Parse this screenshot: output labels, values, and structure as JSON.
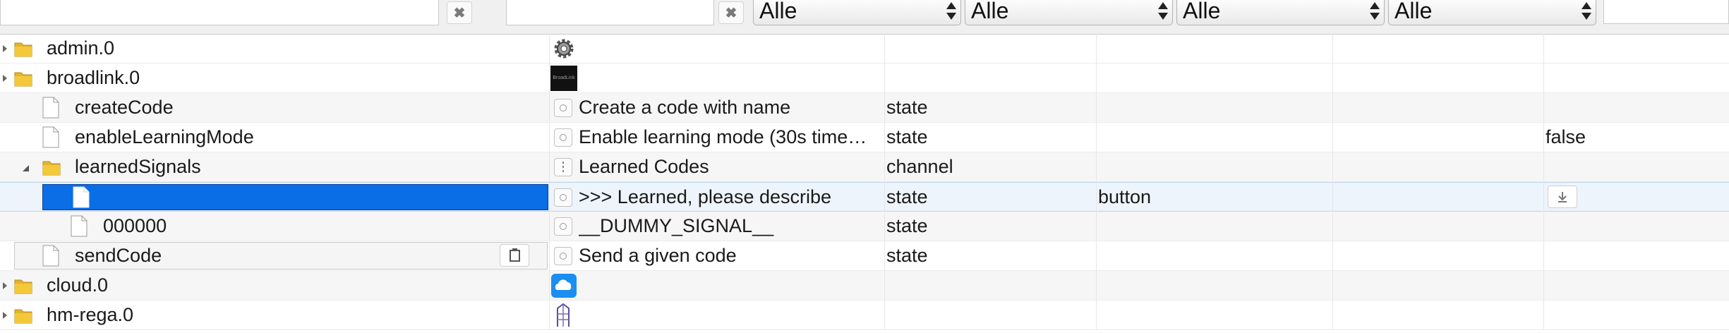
{
  "filters": {
    "name_value": "",
    "id_value": "",
    "clear_label": "✖",
    "selects": [
      "Alle",
      "Alle",
      "Alle",
      "Alle"
    ]
  },
  "rows": [
    {
      "name": "admin.0",
      "type": "folder",
      "expander": "closed",
      "icon": "gear-icon"
    },
    {
      "name": "broadlink.0",
      "type": "folder",
      "expander": "closed",
      "icon": "broadlink-logo-icon",
      "icon_text": "BroadLink"
    },
    {
      "name": "createCode",
      "type": "file",
      "title": "Create a code with name",
      "kind": "state"
    },
    {
      "name": "enableLearningMode",
      "type": "file",
      "title": "Enable learning mode (30s time…",
      "kind": "state",
      "value": "false"
    },
    {
      "name": "learnedSignals",
      "type": "folder",
      "expander": "open",
      "title": "Learned Codes",
      "kind": "channel"
    },
    {
      "name": "",
      "type": "file",
      "selected": true,
      "title": ">>> Learned, please describe",
      "kind": "state",
      "role": "button"
    },
    {
      "name": "000000",
      "type": "file",
      "title": "__DUMMY_SIGNAL__",
      "kind": "state"
    },
    {
      "name": "sendCode",
      "type": "file",
      "title": "Send a given code",
      "kind": "state"
    },
    {
      "name": "cloud.0",
      "type": "folder",
      "expander": "closed",
      "icon": "cloud-icon"
    },
    {
      "name": "hm-rega.0",
      "type": "folder",
      "expander": "closed",
      "icon": "rega-icon"
    }
  ],
  "colors": {
    "selection": "#0a6ee6",
    "folder": "#e3b52a"
  }
}
